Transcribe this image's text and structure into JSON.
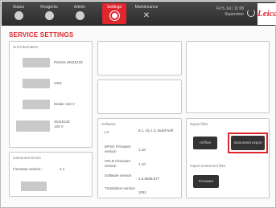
{
  "nav": {
    "tabs": [
      {
        "label": "Status",
        "icon": "status-icon"
      },
      {
        "label": "Reagents",
        "icon": "reagents-icon"
      },
      {
        "label": "Admin",
        "icon": "admin-icon"
      },
      {
        "label": "Settings",
        "icon": "settings-icon"
      },
      {
        "label": "Maintenance",
        "icon": "maintenance-icon"
      }
    ],
    "datetime": "Fri 5 Jul | 11:08",
    "user": "Supervisor",
    "logo": "Leica"
  },
  "page": {
    "title": "SERVICE SETTINGS"
  },
  "unit_info": {
    "title": "Unit information",
    "rows": [
      {
        "value": "Pelonis 45115132"
      },
      {
        "value": "240v"
      },
      {
        "value": "Sealer 120 V"
      },
      {
        "value": "45115132\n120 V"
      }
    ]
  },
  "extra_panel": {
    "title": "Instrument Errors",
    "row_label": "Firmware version :",
    "row_value": "2.1"
  },
  "software": {
    "title": "Software",
    "rows": [
      {
        "label": "LC",
        "value": "8.1, r/p 1.0, Build Nnlf"
      },
      {
        "label": "EPSG Firmware version",
        "value": "1.18"
      },
      {
        "label": "CPLD Firmware version",
        "value": "1.10"
      },
      {
        "label": "Software version",
        "value": "1.0.6565.577"
      },
      {
        "label": "Translation version",
        "value": "1061"
      }
    ]
  },
  "export": {
    "title": "Export files",
    "btn_left": "All files",
    "btn_right": "Instrument export",
    "section2": "Import instrument files",
    "btn_bottom": "Firmware"
  },
  "colors": {
    "accent": "#e0262e",
    "bar": "#333333"
  }
}
